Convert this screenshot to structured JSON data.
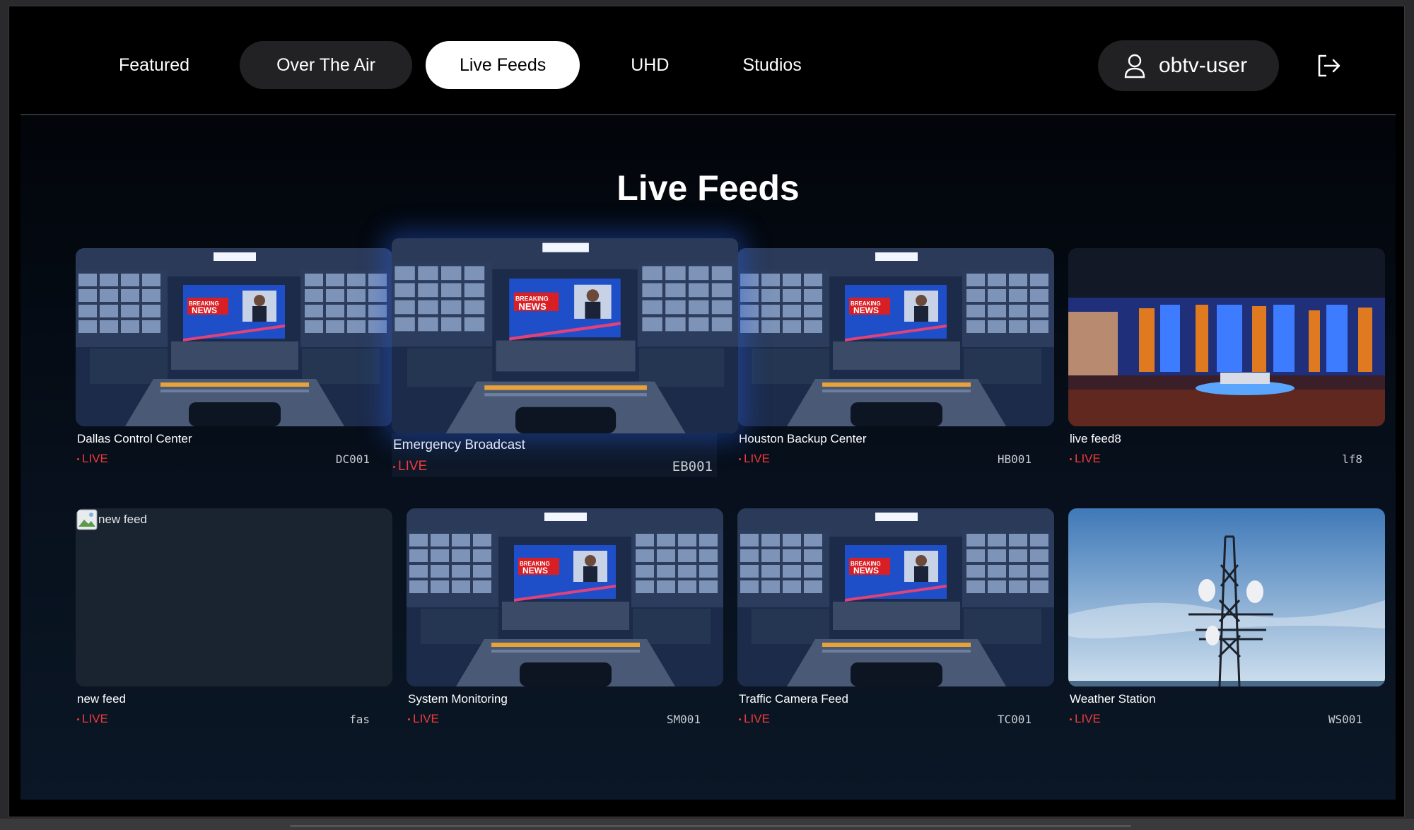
{
  "nav": {
    "tabs": [
      {
        "label": "Featured"
      },
      {
        "label": "Over The Air"
      },
      {
        "label": "Live Feeds"
      },
      {
        "label": "UHD"
      },
      {
        "label": "Studios"
      }
    ],
    "active_tab": "Live Feeds",
    "user": {
      "name": "obtv-user",
      "icon": "user-icon"
    },
    "logout_icon": "logout-icon"
  },
  "page": {
    "title": "Live Feeds"
  },
  "live_label": "LIVE",
  "feeds": [
    {
      "name": "Dallas Control Center",
      "code": "DC001",
      "image": "control-room"
    },
    {
      "name": "Emergency Broadcast",
      "code": "EB001",
      "image": "control-room",
      "focused": true
    },
    {
      "name": "Houston Backup Center",
      "code": "HB001",
      "image": "control-room"
    },
    {
      "name": "live feed8",
      "code": "lf8",
      "image": "studio-set"
    },
    {
      "name": "new feed",
      "code": "fas",
      "image": "broken-image",
      "alt": "new feed"
    },
    {
      "name": "System Monitoring",
      "code": "SM001",
      "image": "control-room"
    },
    {
      "name": "Traffic Camera Feed",
      "code": "TC001",
      "image": "control-room"
    },
    {
      "name": "Weather Station",
      "code": "WS001",
      "image": "cell-tower"
    }
  ],
  "thumbnail_text": {
    "breaking": "BREAKING",
    "news": "NEWS"
  },
  "colors": {
    "live": "#ef3b3b",
    "active_tab_bg": "#ffffff",
    "focus_glow": "#2a5ad8"
  }
}
